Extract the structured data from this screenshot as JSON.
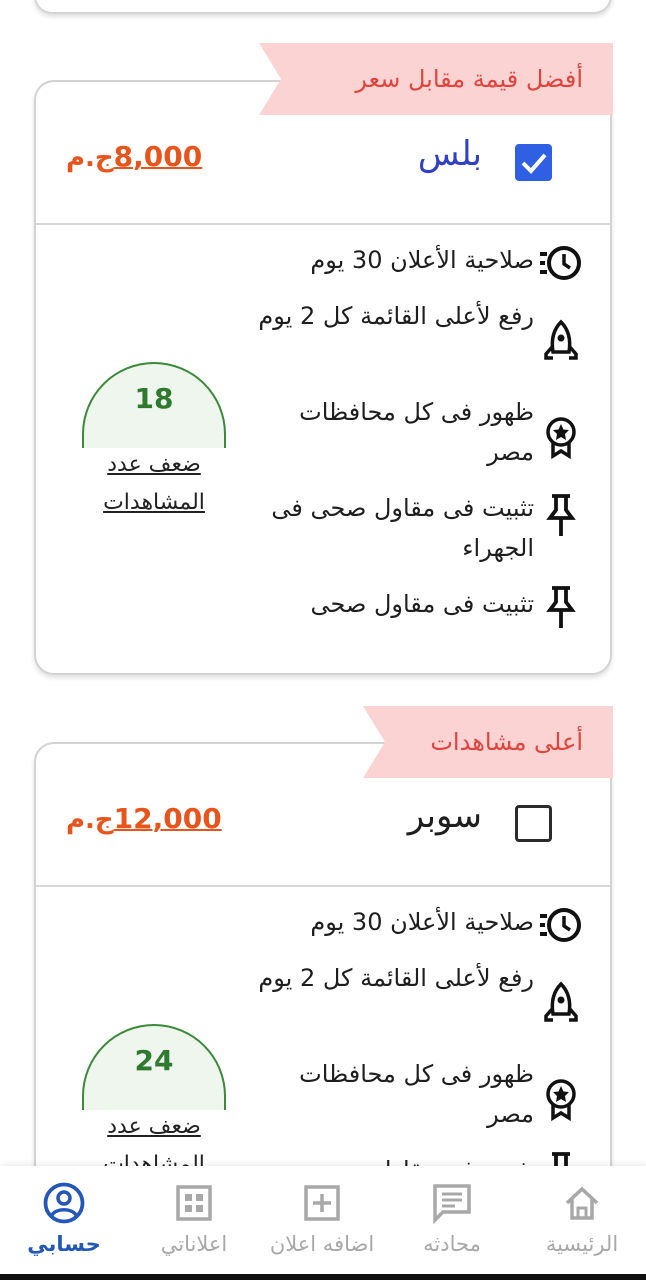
{
  "plans": [
    {
      "ribbon": "أفضل قيمة مقابل سعر",
      "name": "بلس",
      "checked": true,
      "price_amount": "8,000",
      "currency": "ج.م",
      "features": [
        {
          "icon": "clock-list-icon",
          "text": "صلاحية الأعلان 30 يوم"
        },
        {
          "icon": "rocket-icon",
          "text": "رفع لأعلى القائمة كل 2 يوم"
        },
        {
          "icon": "award-badge-icon",
          "text": "ظهور فى كل محافظات مصر"
        },
        {
          "icon": "pin-icon",
          "text": "تثبيت فى مقاول صحى فى الجهراء"
        },
        {
          "icon": "pin-icon",
          "text": "تثبيت فى مقاول صحى"
        }
      ],
      "views_multiplier": "18",
      "views_label": "ضعف عدد المشاهدات"
    },
    {
      "ribbon": "أعلى مشاهدات",
      "name": "سوبر",
      "checked": false,
      "price_amount": "12,000",
      "currency": "ج.م",
      "features": [
        {
          "icon": "clock-list-icon",
          "text": "صلاحية الأعلان 30 يوم"
        },
        {
          "icon": "rocket-icon",
          "text": "رفع لأعلى القائمة كل 2 يوم"
        },
        {
          "icon": "award-badge-icon",
          "text": "ظهور فى كل محافظات مصر"
        },
        {
          "icon": "pin-icon",
          "text": "تثبيت فى مقاول صحى"
        }
      ],
      "views_multiplier": "24",
      "views_label": "ضعف عدد المشاهدات"
    }
  ],
  "bottom_nav": [
    {
      "label": "الرئيسية",
      "icon": "home-icon",
      "active": false
    },
    {
      "label": "محادثه",
      "icon": "chat-icon",
      "active": false
    },
    {
      "label": "اضافه اعلان",
      "icon": "add-box-icon",
      "active": false
    },
    {
      "label": "اعلاناتي",
      "icon": "grid-icon",
      "active": false
    },
    {
      "label": "حسابي",
      "icon": "account-icon",
      "active": true
    }
  ],
  "colors": {
    "accent_blue": "#2f5fe3",
    "price_orange": "#e8541c",
    "ribbon_bg": "#fcd3d3",
    "ribbon_text": "#e0443c",
    "dome_green": "#3a8a3a"
  }
}
